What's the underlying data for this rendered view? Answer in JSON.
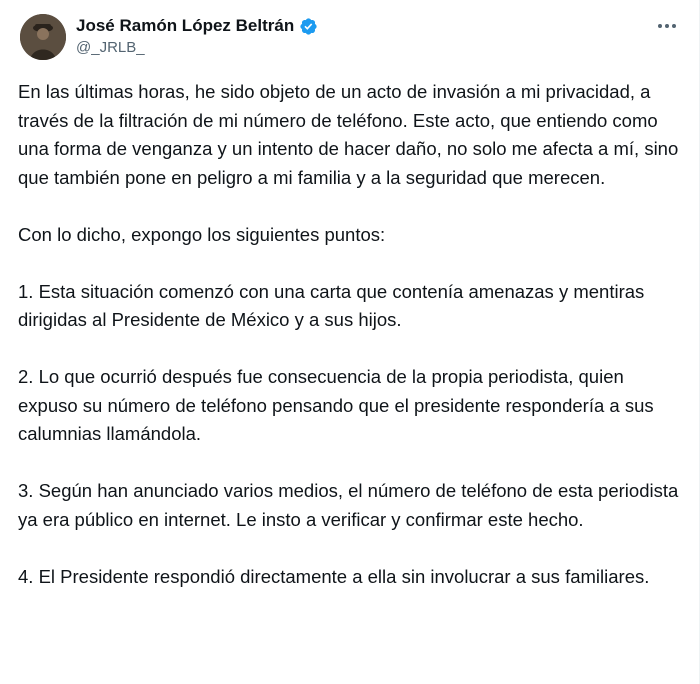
{
  "author": {
    "display_name": "José Ramón López Beltrán",
    "handle": "@_JRLB_",
    "verified": true,
    "verified_color": "#1d9bf0"
  },
  "menu": {
    "icon": "more-horizontal-icon"
  },
  "tweet": {
    "paragraphs": [
      "En las últimas horas, he sido objeto de un acto de invasión a mi privacidad, a través de la filtración de mi número de teléfono. Este acto, que entiendo como una forma de venganza y un intento de hacer daño, no solo me afecta a mí, sino que también pone en peligro a mi familia y a la seguridad que merecen.",
      "Con lo dicho, expongo los siguientes puntos:",
      "1. Esta situación comenzó con una carta que contenía amenazas y mentiras dirigidas al Presidente de México y a sus hijos.",
      "2. Lo que ocurrió después fue consecuencia de la propia periodista, quien expuso su número de teléfono pensando que el presidente respondería a sus calumnias llamándola.",
      "3. Según han anunciado varios medios, el número de teléfono de esta periodista ya era público en internet. Le insto a verificar y confirmar este hecho.",
      "4. El Presidente respondió directamente a ella sin involucrar a sus familiares."
    ]
  }
}
